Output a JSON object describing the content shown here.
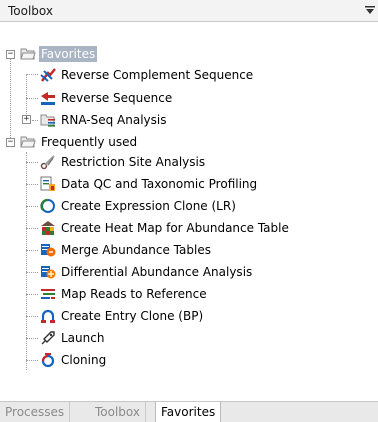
{
  "panel": {
    "title": "Toolbox"
  },
  "tree": {
    "favorites": {
      "label": "Favorites",
      "items": [
        {
          "label": "Reverse Complement Sequence",
          "icon": "reverse-complement-icon"
        },
        {
          "label": "Reverse Sequence",
          "icon": "reverse-sequence-icon"
        },
        {
          "label": "RNA-Seq Analysis",
          "icon": "rna-seq-folder-icon"
        }
      ]
    },
    "frequently_used": {
      "label": "Frequently used",
      "items": [
        {
          "label": "Restriction Site Analysis",
          "icon": "scissors-icon"
        },
        {
          "label": "Data QC and Taxonomic Profiling",
          "icon": "data-qc-icon"
        },
        {
          "label": "Create Expression Clone (LR)",
          "icon": "expression-clone-icon"
        },
        {
          "label": "Create Heat Map for Abundance Table",
          "icon": "heat-map-icon"
        },
        {
          "label": "Merge Abundance Tables",
          "icon": "merge-tables-icon"
        },
        {
          "label": "Differential Abundance Analysis",
          "icon": "differential-abundance-icon"
        },
        {
          "label": "Map Reads to Reference",
          "icon": "map-reads-icon"
        },
        {
          "label": "Create Entry Clone (BP)",
          "icon": "entry-clone-icon"
        },
        {
          "label": "Launch",
          "icon": "launch-icon"
        },
        {
          "label": "Cloning",
          "icon": "cloning-icon"
        }
      ]
    }
  },
  "tabs": [
    {
      "label": "Processes",
      "active": false
    },
    {
      "label": "Toolbox",
      "active": false
    },
    {
      "label": "Favorites",
      "active": true
    }
  ]
}
